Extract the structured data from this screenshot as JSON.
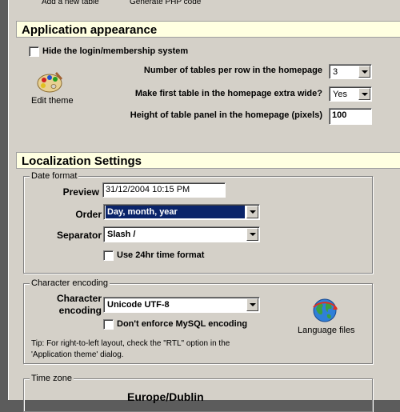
{
  "toolbar": {
    "add_table": "Add a new table",
    "generate_php": "Generate PHP code"
  },
  "appearance": {
    "title": "Application appearance",
    "hide_login_label": "Hide the login/membership system",
    "edit_theme_label": "Edit theme",
    "tables_per_row_label": "Number of tables per row in the homepage",
    "tables_per_row_value": "3",
    "first_wide_label": "Make first table in the homepage extra wide?",
    "first_wide_value": "Yes",
    "panel_height_label": "Height of table panel in the homepage (pixels)",
    "panel_height_value": "100"
  },
  "localization": {
    "title": "Localization Settings",
    "date_format": {
      "legend": "Date format",
      "preview_label": "Preview",
      "preview_value": "31/12/2004 10:15 PM",
      "order_label": "Order",
      "order_value": "Day, month, year",
      "separator_label": "Separator",
      "separator_value": "Slash /",
      "use24_label": "Use 24hr time format"
    },
    "encoding": {
      "legend": "Character encoding",
      "label_line1": "Character",
      "label_line2": "encoding",
      "value": "Unicode UTF-8",
      "dont_enforce_label": "Don't enforce MySQL encoding",
      "language_files_label": "Language files",
      "tip_line1": "Tip: For right-to-left layout, check the \"RTL\" option in the",
      "tip_line2": "'Application theme' dialog."
    },
    "timezone": {
      "legend": "Time zone",
      "value": "Europe/Dublin"
    }
  },
  "colors": {
    "header_bg": "#ffffe1",
    "panel_bg": "#d4d0c8",
    "selection": "#0a246a",
    "outside_bg": "#5c5c5c"
  }
}
